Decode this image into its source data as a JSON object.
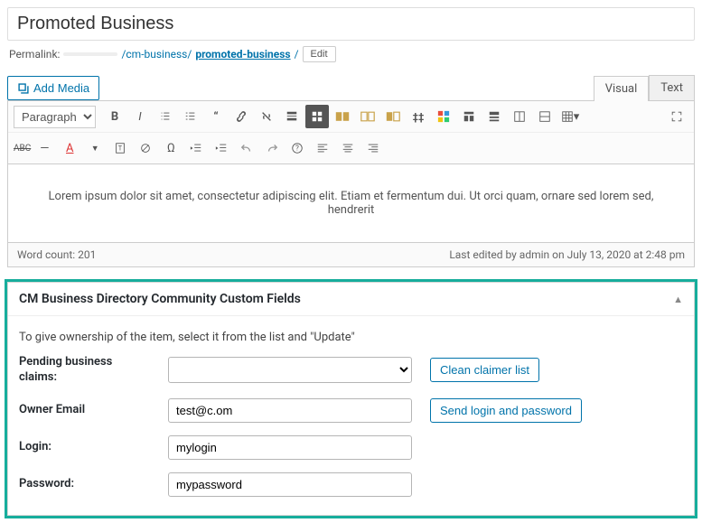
{
  "title": "Promoted Business",
  "permalink": {
    "label": "Permalink:",
    "path": "/cm-business/",
    "slug": "promoted-business",
    "trail": "/",
    "edit": "Edit"
  },
  "editor": {
    "add_media": "Add Media",
    "tabs": {
      "visual": "Visual",
      "text": "Text"
    },
    "paragraph": "Paragraph",
    "abc": "ABC",
    "content": "Lorem ipsum dolor sit amet, consectetur adipiscing elit. Etiam et fermentum dui. Ut orci quam, ornare sed lorem sed, hendrerit",
    "footer": {
      "wordcount": "Word count: 201",
      "last_edited": "Last edited by admin on July 13, 2020 at 2:48 pm"
    }
  },
  "metabox": {
    "title": "CM Business Directory Community Custom Fields",
    "helper": "To give ownership of the item, select it from the list and \"Update\"",
    "rows": {
      "pending": {
        "label": "Pending business claims:",
        "btn": "Clean claimer list"
      },
      "owner": {
        "label": "Owner Email",
        "value": "test@c.om",
        "btn": "Send login and password"
      },
      "login": {
        "label": "Login:",
        "value": "mylogin"
      },
      "password": {
        "label": "Password:",
        "value": "mypassword"
      }
    }
  }
}
